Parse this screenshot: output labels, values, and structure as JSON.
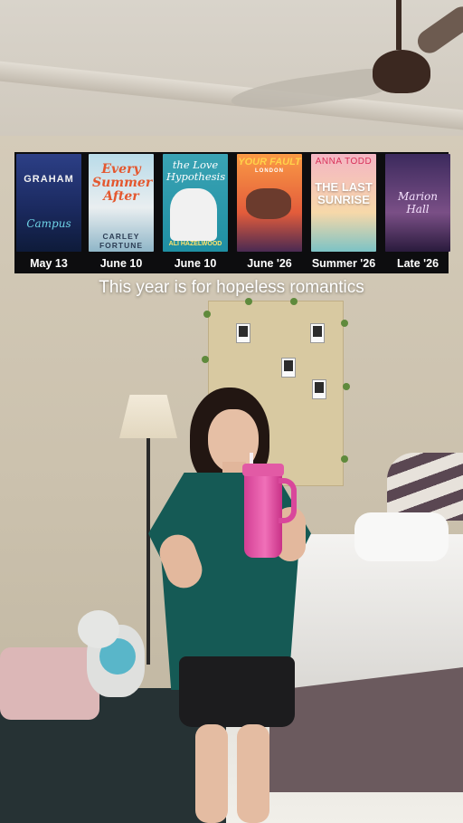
{
  "books": [
    {
      "title": "GRAHAM",
      "subtitle": "Campus",
      "date": "May 13"
    },
    {
      "title": "Every Summer After",
      "author": "CARLEY FORTUNE",
      "date": "June 10"
    },
    {
      "title": "the Love Hypothesis",
      "author": "ALI HAZELWOOD",
      "date": "June 10"
    },
    {
      "title": "YOUR FAULT",
      "subtitle": "LONDON",
      "date": "June '26"
    },
    {
      "title": "THE LAST SUNRISE",
      "author": "ANNA TODD",
      "date": "Summer '26"
    },
    {
      "title": "Marion Hall",
      "date": "Late '26"
    }
  ],
  "caption": "This year is for hopeless romantics",
  "colors": {
    "strip": "#0d0d0f",
    "caption": "#ffffff",
    "tumbler": "#f070b8",
    "top": "#155a55"
  }
}
